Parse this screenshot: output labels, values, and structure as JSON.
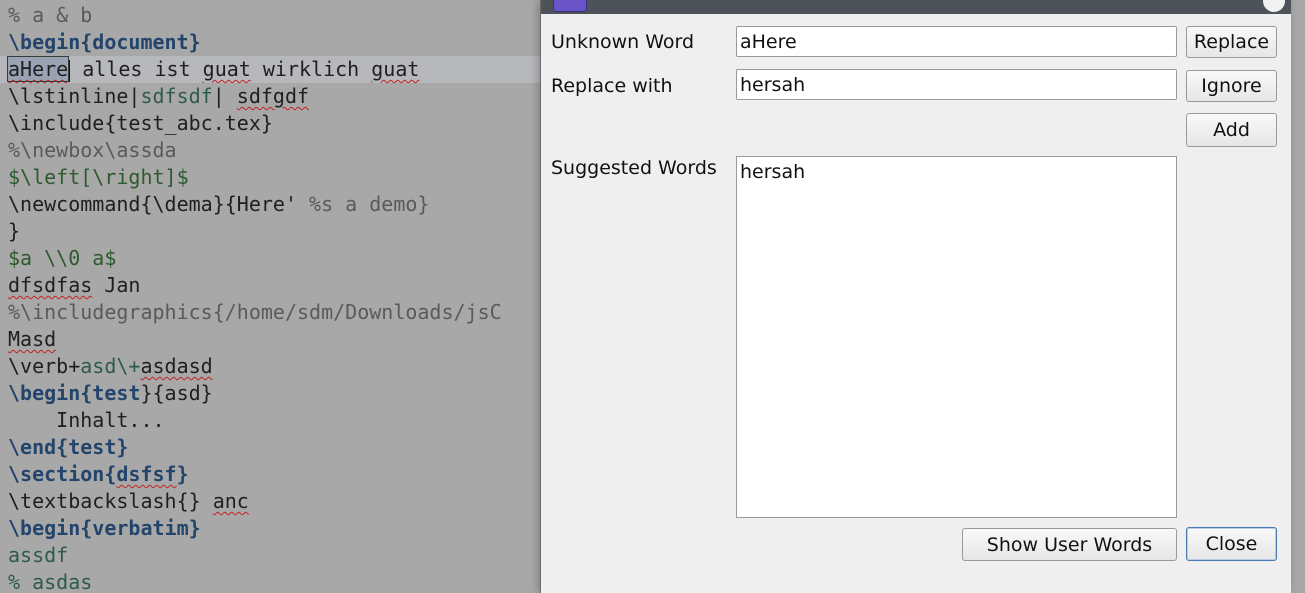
{
  "editor": {
    "lines": [
      {
        "segments": [
          {
            "t": "% a & b",
            "c": "cmt"
          }
        ]
      },
      {
        "segments": [
          {
            "t": "\\begin{",
            "c": "kw-light"
          },
          {
            "t": "document",
            "c": "kw"
          },
          {
            "t": "}",
            "c": "kw-light"
          }
        ]
      },
      {
        "current": true,
        "segments": [
          {
            "t": "aHere",
            "c": "sel spell"
          },
          {
            "t": "",
            "c": "caret"
          },
          {
            "t": " alles ist ",
            "c": ""
          },
          {
            "t": "guat",
            "c": "spell"
          },
          {
            "t": " wirklich ",
            "c": ""
          },
          {
            "t": "guat",
            "c": "spell"
          }
        ]
      },
      {
        "segments": [
          {
            "t": "\\lstinline|",
            "c": ""
          },
          {
            "t": "sdfsdf",
            "c": "verb"
          },
          {
            "t": "| ",
            "c": ""
          },
          {
            "t": "sdfgdf",
            "c": "spell"
          }
        ]
      },
      {
        "segments": [
          {
            "t": "\\include{test_abc.tex}",
            "c": ""
          }
        ]
      },
      {
        "segments": [
          {
            "t": "%\\newbox\\assda",
            "c": "cmt"
          }
        ]
      },
      {
        "segments": [
          {
            "t": "$\\left[\\right]$",
            "c": "math"
          }
        ]
      },
      {
        "segments": [
          {
            "t": "\\newcommand{\\dema}{Here' ",
            "c": ""
          },
          {
            "t": "%s a demo}",
            "c": "cmt"
          }
        ]
      },
      {
        "segments": [
          {
            "t": "}",
            "c": ""
          }
        ]
      },
      {
        "segments": [
          {
            "t": "$a \\\\0 a$",
            "c": "math"
          }
        ]
      },
      {
        "segments": [
          {
            "t": "dfsdfas",
            "c": "spell"
          },
          {
            "t": " Jan",
            "c": ""
          }
        ]
      },
      {
        "segments": [
          {
            "t": "%\\includegraphics{/home/sdm/Downloads/jsC",
            "c": "cmt"
          }
        ]
      },
      {
        "segments": [
          {
            "t": "Masd",
            "c": "spell"
          }
        ]
      },
      {
        "segments": [
          {
            "t": "\\verb+",
            "c": ""
          },
          {
            "t": "asd\\+",
            "c": "verb"
          },
          {
            "t": "asdasd",
            "c": "spell"
          }
        ]
      },
      {
        "segments": [
          {
            "t": "\\begin{",
            "c": "kw-light"
          },
          {
            "t": "test",
            "c": "kw"
          },
          {
            "t": "}{asd}",
            "c": ""
          }
        ]
      },
      {
        "segments": [
          {
            "t": "    Inhalt...",
            "c": ""
          }
        ]
      },
      {
        "segments": [
          {
            "t": "\\end{",
            "c": "kw-light"
          },
          {
            "t": "test",
            "c": "kw"
          },
          {
            "t": "}",
            "c": "kw-light"
          }
        ]
      },
      {
        "segments": [
          {
            "t": "\\section{",
            "c": "kw-light"
          },
          {
            "t": "dsfsf",
            "c": "kw spell"
          },
          {
            "t": "}",
            "c": "kw-light"
          }
        ]
      },
      {
        "segments": [
          {
            "t": "\\textbackslash{} ",
            "c": ""
          },
          {
            "t": "anc",
            "c": "spell"
          }
        ]
      },
      {
        "segments": [
          {
            "t": "\\begin{",
            "c": "kw-light"
          },
          {
            "t": "verbatim",
            "c": "kw"
          },
          {
            "t": "}",
            "c": "kw-light"
          }
        ]
      },
      {
        "segments": [
          {
            "t": "assdf",
            "c": "verb"
          }
        ]
      },
      {
        "segments": [
          {
            "t": "% asdas",
            "c": "verb"
          }
        ]
      }
    ]
  },
  "dialog": {
    "unknown_word_label": "Unknown Word",
    "unknown_word_value": "aHere",
    "replace_with_label": "Replace with",
    "replace_with_value": "hersah",
    "suggested_words_label": "Suggested Words",
    "suggestions": [
      "hersah"
    ],
    "buttons": {
      "replace": "Replace",
      "ignore": "Ignore",
      "add": "Add",
      "show_user_words": "Show User Words",
      "close": "Close"
    }
  },
  "colors": {
    "keyword": "#23446b",
    "comment": "#5a5a5a",
    "math": "#2e5a2e",
    "spell_error": "#c22323",
    "dialog_bg": "#efefef",
    "titlebar": "#4d5359"
  }
}
